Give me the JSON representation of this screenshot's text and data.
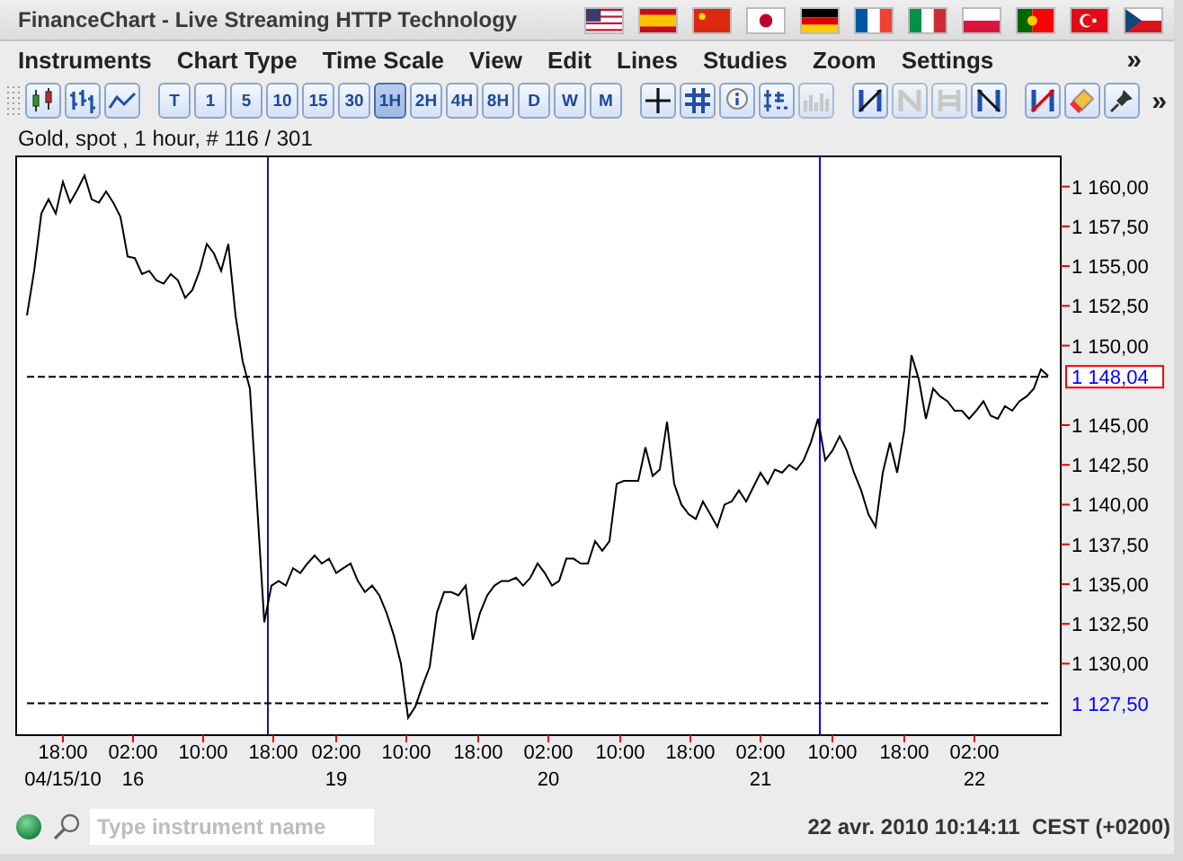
{
  "window": {
    "title": "FinanceChart - Live Streaming HTTP Technology"
  },
  "menu": {
    "items": [
      "Instruments",
      "Chart Type",
      "Time Scale",
      "View",
      "Edit",
      "Lines",
      "Studies",
      "Zoom",
      "Settings"
    ],
    "overflow": "»"
  },
  "toolbar": {
    "time_scales": [
      {
        "label": "T",
        "selected": false
      },
      {
        "label": "1",
        "selected": false
      },
      {
        "label": "5",
        "selected": false
      },
      {
        "label": "10",
        "selected": false
      },
      {
        "label": "15",
        "selected": false
      },
      {
        "label": "30",
        "selected": false
      },
      {
        "label": "1H",
        "selected": true
      },
      {
        "label": "2H",
        "selected": false
      },
      {
        "label": "4H",
        "selected": false
      },
      {
        "label": "8H",
        "selected": false
      },
      {
        "label": "D",
        "selected": false
      },
      {
        "label": "W",
        "selected": false
      },
      {
        "label": "M",
        "selected": false
      }
    ],
    "view_tools": [
      {
        "kind": "crosshair",
        "disabled": false
      },
      {
        "kind": "grid",
        "disabled": false
      },
      {
        "kind": "info",
        "disabled": false
      },
      {
        "kind": "scale",
        "disabled": false
      },
      {
        "kind": "volume",
        "disabled": true
      }
    ],
    "line_tools": [
      {
        "kind": "trend",
        "disabled": false
      },
      {
        "kind": "channel",
        "disabled": true
      },
      {
        "kind": "parallel",
        "disabled": true
      },
      {
        "kind": "reverse",
        "disabled": false
      }
    ],
    "overflow": "»"
  },
  "chart": {
    "caption": "Gold, spot , 1 hour, # 116 / 301",
    "chart_data": {
      "type": "line",
      "ylim": [
        1125.5,
        1161.9
      ],
      "series": [
        {
          "color": "#000000",
          "values": [
            1151.9,
            1154.7,
            1158.3,
            1159.2,
            1158.3,
            1160.3,
            1159.0,
            1159.8,
            1160.7,
            1159.2,
            1159.0,
            1159.7,
            1159.0,
            1158.1,
            1155.6,
            1155.5,
            1154.5,
            1154.7,
            1154.1,
            1153.9,
            1154.5,
            1154.1,
            1153.0,
            1153.5,
            1154.7,
            1156.4,
            1155.8,
            1154.7,
            1156.4,
            1151.9,
            1149.0,
            1147.3,
            1140.0,
            1132.6,
            1134.9,
            1135.2,
            1134.9,
            1136.0,
            1135.7,
            1136.3,
            1136.8,
            1136.3,
            1136.6,
            1135.7,
            1136.0,
            1136.3,
            1135.2,
            1134.5,
            1134.9,
            1134.3,
            1133.2,
            1131.8,
            1130.0,
            1126.6,
            1127.3,
            1128.6,
            1129.8,
            1133.2,
            1134.5,
            1134.5,
            1134.3,
            1134.9,
            1131.5,
            1133.2,
            1134.3,
            1134.9,
            1135.2,
            1135.2,
            1135.4,
            1134.9,
            1135.4,
            1136.3,
            1135.7,
            1134.9,
            1135.2,
            1136.6,
            1136.6,
            1136.3,
            1136.3,
            1137.7,
            1137.1,
            1137.7,
            1141.3,
            1141.5,
            1141.5,
            1141.5,
            1143.6,
            1141.8,
            1142.2,
            1145.2,
            1141.3,
            1140.0,
            1139.4,
            1139.1,
            1140.2,
            1139.4,
            1138.6,
            1140.0,
            1140.2,
            1140.9,
            1140.2,
            1141.1,
            1142.0,
            1141.3,
            1142.2,
            1142.0,
            1142.5,
            1142.2,
            1142.8,
            1143.9,
            1145.4,
            1142.8,
            1143.4,
            1144.3,
            1143.4,
            1142.0,
            1140.9,
            1139.4,
            1138.6,
            1142.0,
            1143.9,
            1142.0,
            1144.7,
            1149.4,
            1147.9,
            1145.4,
            1147.3,
            1146.8,
            1146.5,
            1145.9,
            1145.9,
            1145.4,
            1145.9,
            1146.5,
            1145.6,
            1145.4,
            1146.2,
            1145.9,
            1146.5,
            1146.8,
            1147.3,
            1148.5,
            1148.1
          ]
        },
        {
          "name": "1 148,04",
          "color": "#000000",
          "line_style": "dashed",
          "values": [
            1148.04,
            1148.04,
            1148.04,
            1148.04,
            1148.04,
            1148.04,
            1148.04,
            1148.04,
            1148.04,
            1148.04,
            1148.04,
            1148.04,
            1148.04,
            1148.04,
            1148.04,
            1148.04,
            1148.04,
            1148.04,
            1148.04,
            1148.04,
            1148.04,
            1148.04,
            1148.04,
            1148.04,
            1148.04,
            1148.04,
            1148.04,
            1148.04,
            1148.04,
            1148.04,
            1148.04,
            1148.04,
            1148.04,
            1148.04,
            1148.04,
            1148.04,
            1148.04,
            1148.04,
            1148.04,
            1148.04,
            1148.04,
            1148.04,
            1148.04,
            1148.04,
            1148.04,
            1148.04,
            1148.04,
            1148.04,
            1148.04,
            1148.04,
            1148.04,
            1148.04,
            1148.04,
            1148.04,
            1148.04,
            1148.04,
            1148.04,
            1148.04,
            1148.04,
            1148.04,
            1148.04,
            1148.04,
            1148.04,
            1148.04,
            1148.04,
            1148.04,
            1148.04,
            1148.04,
            1148.04,
            1148.04,
            1148.04,
            1148.04,
            1148.04,
            1148.04,
            1148.04,
            1148.04,
            1148.04,
            1148.04,
            1148.04,
            1148.04,
            1148.04,
            1148.04,
            1148.04,
            1148.04,
            1148.04,
            1148.04,
            1148.04,
            1148.04,
            1148.04,
            1148.04,
            1148.04,
            1148.04,
            1148.04,
            1148.04,
            1148.04,
            1148.04,
            1148.04,
            1148.04,
            1148.04,
            1148.04,
            1148.04,
            1148.04,
            1148.04,
            1148.04,
            1148.04,
            1148.04,
            1148.04,
            1148.04,
            1148.04,
            1148.04,
            1148.04,
            1148.04,
            1148.04,
            1148.04,
            1148.04,
            1148.04,
            1148.04,
            1148.04,
            1148.04,
            1148.04,
            1148.04,
            1148.04,
            1148.04,
            1148.04,
            1148.04,
            1148.04,
            1148.04,
            1148.04,
            1148.04,
            1148.04,
            1148.04,
            1148.04,
            1148.04,
            1148.04,
            1148.04,
            1148.04,
            1148.04,
            1148.04,
            1148.04,
            1148.04,
            1148.04,
            1148.04,
            1148.04
          ]
        },
        {
          "name": "1 127,50",
          "color": "#000000",
          "line_style": "dashed",
          "values": [
            1127.5,
            1127.5,
            1127.5,
            1127.5,
            1127.5,
            1127.5,
            1127.5,
            1127.5,
            1127.5,
            1127.5,
            1127.5,
            1127.5,
            1127.5,
            1127.5,
            1127.5,
            1127.5,
            1127.5,
            1127.5,
            1127.5,
            1127.5,
            1127.5,
            1127.5,
            1127.5,
            1127.5,
            1127.5,
            1127.5,
            1127.5,
            1127.5,
            1127.5,
            1127.5,
            1127.5,
            1127.5,
            1127.5,
            1127.5,
            1127.5,
            1127.5,
            1127.5,
            1127.5,
            1127.5,
            1127.5,
            1127.5,
            1127.5,
            1127.5,
            1127.5,
            1127.5,
            1127.5,
            1127.5,
            1127.5,
            1127.5,
            1127.5,
            1127.5,
            1127.5,
            1127.5,
            1127.5,
            1127.5,
            1127.5,
            1127.5,
            1127.5,
            1127.5,
            1127.5,
            1127.5,
            1127.5,
            1127.5,
            1127.5,
            1127.5,
            1127.5,
            1127.5,
            1127.5,
            1127.5,
            1127.5,
            1127.5,
            1127.5,
            1127.5,
            1127.5,
            1127.5,
            1127.5,
            1127.5,
            1127.5,
            1127.5,
            1127.5,
            1127.5,
            1127.5,
            1127.5,
            1127.5,
            1127.5,
            1127.5,
            1127.5,
            1127.5,
            1127.5,
            1127.5,
            1127.5,
            1127.5,
            1127.5,
            1127.5,
            1127.5,
            1127.5,
            1127.5,
            1127.5,
            1127.5,
            1127.5,
            1127.5,
            1127.5,
            1127.5,
            1127.5,
            1127.5,
            1127.5,
            1127.5,
            1127.5,
            1127.5,
            1127.5,
            1127.5,
            1127.5,
            1127.5,
            1127.5,
            1127.5,
            1127.5,
            1127.5,
            1127.5,
            1127.5,
            1127.5,
            1127.5,
            1127.5,
            1127.5,
            1127.5,
            1127.5,
            1127.5,
            1127.5,
            1127.5,
            1127.5,
            1127.5,
            1127.5,
            1127.5,
            1127.5,
            1127.5,
            1127.5,
            1127.5,
            1127.5,
            1127.5,
            1127.5,
            1127.5,
            1127.5,
            1127.5,
            1127.5
          ]
        }
      ],
      "yticks": [
        {
          "value": 1160,
          "label": "1 160,00"
        },
        {
          "value": 1157.5,
          "label": "1 157,50"
        },
        {
          "value": 1155,
          "label": "1 155,00"
        },
        {
          "value": 1152.5,
          "label": "1 152,50"
        },
        {
          "value": 1150,
          "label": "1 150,00"
        },
        {
          "value": 1145,
          "label": "1 145,00"
        },
        {
          "value": 1142.5,
          "label": "1 142,50"
        },
        {
          "value": 1140,
          "label": "1 140,00"
        },
        {
          "value": 1137.5,
          "label": "1 137,50"
        },
        {
          "value": 1135,
          "label": "1 135,00"
        },
        {
          "value": 1132.5,
          "label": "1 132,50"
        },
        {
          "value": 1130,
          "label": "1 130,00"
        }
      ],
      "ylabel": null
    },
    "time_labels": [
      "18:00",
      "02:00",
      "10:00",
      "18:00",
      "02:00",
      "10:00",
      "18:00",
      "02:00",
      "10:00",
      "18:00",
      "02:00",
      "10:00",
      "18:00",
      "02:00"
    ],
    "date_labels": [
      "04/15/10",
      "16",
      "19",
      "20",
      "21",
      "22"
    ]
  },
  "status_bar": {
    "search": {
      "placeholder": "Type instrument name"
    },
    "clock": "22 avr. 2010 10:14:11  CEST (+0200)"
  }
}
